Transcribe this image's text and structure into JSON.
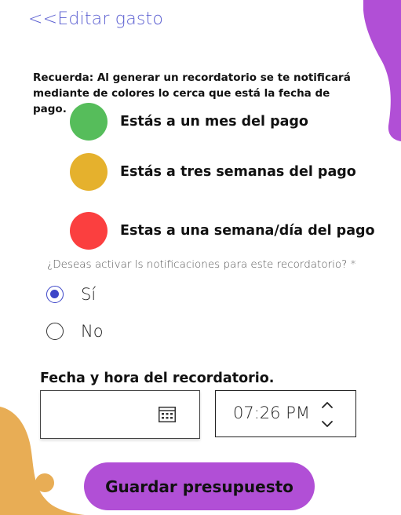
{
  "nav": {
    "back_label": "<<Editar gasto"
  },
  "reminder": {
    "note": "Recuerda: Al generar un recordatorio se te notificará mediante de colores lo cerca que está la fecha de pago."
  },
  "legend": [
    {
      "color": "#56bd5b",
      "label": "Estás a un mes del pago"
    },
    {
      "color": "#e5b12d",
      "label": "Estás a tres semanas del pago"
    },
    {
      "color": "#fb3f3f",
      "label": "Estas a una semana/día del pago"
    }
  ],
  "notifications": {
    "question": "¿Deseas activar ls notificaciones para este recordatorio? *",
    "options": [
      {
        "label": "Sí",
        "selected": true
      },
      {
        "label": "No",
        "selected": false
      }
    ]
  },
  "datetime": {
    "heading": "Fecha y hora del recordatorio.",
    "date_value": "",
    "time_value": "07:26 PM"
  },
  "actions": {
    "save_label": "Guardar presupuesto"
  },
  "colors": {
    "accent_purple": "#b14fd6",
    "blob_orange": "#e8ad55",
    "link_blue": "#5b5fd1",
    "radio_blue": "#3d46c8"
  }
}
